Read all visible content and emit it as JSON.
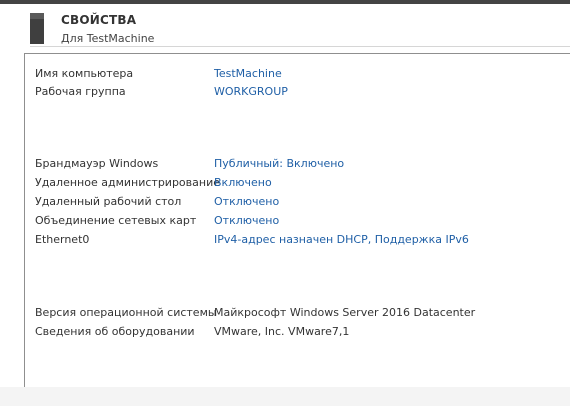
{
  "header": {
    "title": "СВОЙСТВА",
    "subtitle": "Для TestMachine",
    "icon": "server-icon"
  },
  "properties": {
    "computer_name": {
      "label": "Имя компьютера",
      "value": "TestMachine"
    },
    "workgroup": {
      "label": "Рабочая группа",
      "value": "WORKGROUP"
    },
    "firewall": {
      "label": "Брандмауэр Windows",
      "value": "Публичный: Включено"
    },
    "remote_mgmt": {
      "label": "Удаленное администрирование",
      "value": "Включено"
    },
    "remote_desktop": {
      "label": "Удаленный рабочий стол",
      "value": "Отключено"
    },
    "nic_teaming": {
      "label": "Объединение сетевых карт",
      "value": "Отключено"
    },
    "ethernet": {
      "label": "Ethernet0",
      "value": "IPv4-адрес назначен DHCP, Поддержка IPv6"
    },
    "os_version": {
      "label": "Версия операционной системы",
      "value": "Майкрософт Windows Server 2016 Datacenter"
    },
    "hardware": {
      "label": "Сведения об оборудовании",
      "value": "VMware, Inc. VMware7,1"
    }
  },
  "colors": {
    "link": "#1f5fa6",
    "text": "#333333",
    "border": "#8f8f8f"
  }
}
